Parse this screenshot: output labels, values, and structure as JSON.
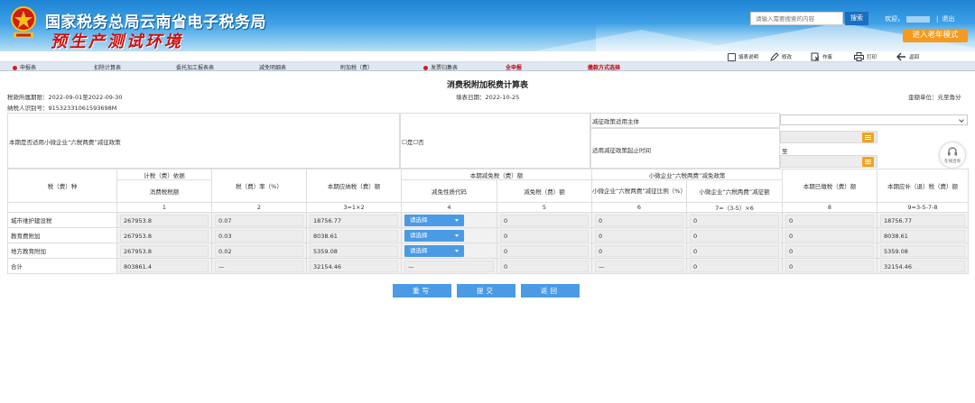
{
  "header": {
    "site_name": "国家税务总局云南省电子税务局",
    "environment": "预生产测试环境",
    "search_placeholder": "请输入需要搜索的内容",
    "search_label": "搜索",
    "welcome": "欢迎，",
    "logout": "退出",
    "elder_mode": "进入老年模式",
    "accent": "#1e84d4",
    "elder_color": "#f39a1f"
  },
  "toolbar": {
    "items": [
      {
        "label": "填表说明",
        "icon": "document-icon"
      },
      {
        "label": "修改",
        "icon": "edit-icon"
      },
      {
        "label": "作废",
        "icon": "void-icon"
      },
      {
        "label": "打印",
        "icon": "print-icon"
      },
      {
        "label": "返回",
        "icon": "back-icon"
      }
    ]
  },
  "tabs": [
    {
      "label": "申报表",
      "marked": true
    },
    {
      "label": "扣除计算表",
      "marked": false
    },
    {
      "label": "委托加工报表表",
      "marked": false
    },
    {
      "label": "减免明细表",
      "marked": false
    },
    {
      "label": "附加税（费）",
      "marked": false
    },
    {
      "label": "发票归集表",
      "marked": true
    },
    {
      "label": "全申报",
      "marked": false,
      "highlight": true
    },
    {
      "label": "缴款方式选择",
      "marked": false,
      "highlight": true
    }
  ],
  "form": {
    "title": "消费税附加税费计算表",
    "period": "税款所属期限：2022-09-01至2022-09-30",
    "taxpayer_id": "纳税人识别号：91532331061593698M",
    "fill_date": "填表日期：2022-10-25",
    "unit": "金额单位：元至角分"
  },
  "policy": {
    "question": "本期是否适用小微企业“六税两费”减征政策",
    "yes": "是",
    "no": "否",
    "subject_label": "减征政策适用主体",
    "period_label": "适用减征政策起止时间",
    "to": "至",
    "help": "在线咨询"
  },
  "table": {
    "h_tax_type": "税（费）种",
    "h_basis": "计税（费）依据",
    "h_consumption": "消费税税额",
    "h_rate": "税（费）率（%）",
    "h_payable": "本期应纳税（费）额",
    "h_reduction": "本期减免税（费）额",
    "h_reduction_code": "减免性质代码",
    "h_reduction_amount": "减免税（费）额",
    "h_small": "小微企业“六税两费”减免政策",
    "h_small_ratio": "小微企业“六税两费”减征比例（%）",
    "h_small_amount": "小微企业“六税两费”减征额",
    "h_paid": "本期已缴税（费）额",
    "h_refund": "本期应补（退）税（费）额",
    "col_numbers": [
      "1",
      "2",
      "3=1×2",
      "4",
      "5",
      "6",
      "7=（3-5）×6",
      "8",
      "9=3-5-7-8"
    ],
    "rows": [
      {
        "name": "城市维护建设税",
        "base": "267953.8",
        "rate": "0.07",
        "payable": "18756.77",
        "code": "请选择",
        "reduction": "0",
        "ratio": "0",
        "small": "0",
        "paid": "0",
        "refund": "18756.77"
      },
      {
        "name": "教育费附加",
        "base": "267953.8",
        "rate": "0.03",
        "payable": "8038.61",
        "code": "请选择",
        "reduction": "0",
        "ratio": "0",
        "small": "0",
        "paid": "0",
        "refund": "8038.61"
      },
      {
        "name": "地方教育附加",
        "base": "267953.8",
        "rate": "0.02",
        "payable": "5359.08",
        "code": "请选择",
        "reduction": "0",
        "ratio": "0",
        "small": "0",
        "paid": "0",
        "refund": "5359.08"
      }
    ],
    "total": {
      "name": "合计",
      "base": "803861.4",
      "rate": "—",
      "payable": "32154.46",
      "code": "—",
      "reduction": "0",
      "ratio": "—",
      "small": "0",
      "paid": "0",
      "refund": "32154.46"
    }
  },
  "actions": {
    "reset": "重写",
    "submit": "提交",
    "back": "返回"
  }
}
